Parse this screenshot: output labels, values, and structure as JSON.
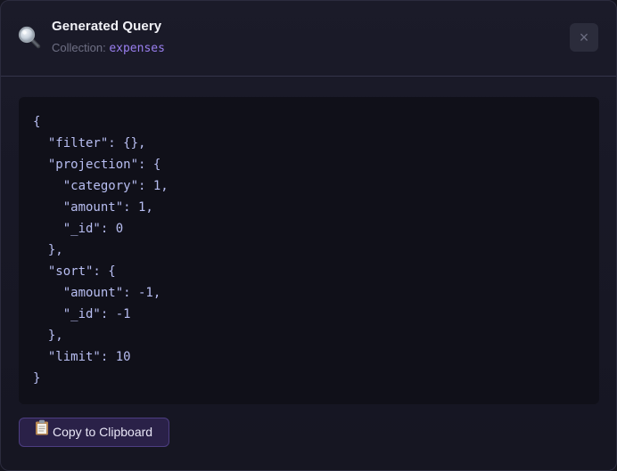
{
  "header": {
    "icon": "magnifying-glass-icon",
    "title": "Generated Query",
    "collection_label": "Collection:",
    "collection_value": "expenses",
    "close_label": "×"
  },
  "query": {
    "code": "{\n  \"filter\": {},\n  \"projection\": {\n    \"category\": 1,\n    \"amount\": 1,\n    \"_id\": 0\n  },\n  \"sort\": {\n    \"amount\": -1,\n    \"_id\": -1\n  },\n  \"limit\": 10\n}"
  },
  "actions": {
    "copy_icon": "clipboard-icon",
    "copy_label": "Copy to Clipboard"
  },
  "colors": {
    "accent": "#9a7ff0",
    "code_text": "#b8bef2",
    "background": "#181826"
  }
}
